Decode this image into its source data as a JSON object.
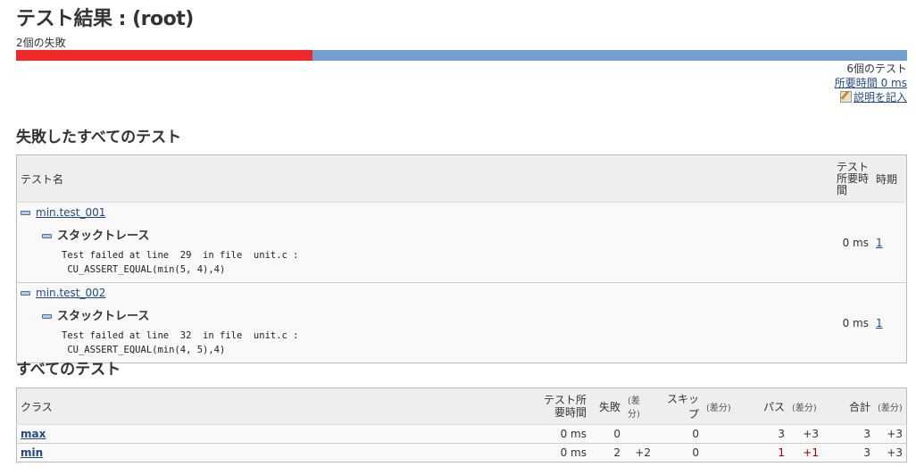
{
  "title": "テスト結果 : (root)",
  "failure_summary": "2個の失敗",
  "progress": {
    "failed": 2,
    "total": 6,
    "fail_fraction": 0.333,
    "fail_color": "#ef2929",
    "pass_color": "#729fcf"
  },
  "summary": {
    "test_count": "6個のテスト",
    "duration": "所要時間 0 ms",
    "edit_description": "説明を記入",
    "edit_icon": "notepad-pencil-icon"
  },
  "failed_section": {
    "heading": "失敗したすべてのテスト",
    "headers": {
      "name": "テスト名",
      "duration": "テスト所要時間",
      "age": "時期"
    },
    "rows": [
      {
        "name": "min.test_001",
        "trace_label": "スタックトレース",
        "trace_line1": "Test failed at line  29  in file  unit.c :",
        "trace_line2": " CU_ASSERT_EQUAL(min(5, 4),4)",
        "duration": "0 ms",
        "age": "1"
      },
      {
        "name": "min.test_002",
        "trace_label": "スタックトレース",
        "trace_line1": "Test failed at line  32  in file  unit.c :",
        "trace_line2": " CU_ASSERT_EQUAL(min(4, 5),4)",
        "duration": "0 ms",
        "age": "1"
      }
    ]
  },
  "all_section": {
    "heading": "すべてのテスト",
    "headers": {
      "class": "クラス",
      "duration": "テスト所要時間",
      "fail": "失敗",
      "skip": "スキップ",
      "pass": "パス",
      "total": "合計",
      "diff": "(差分)"
    },
    "rows": [
      {
        "class": "max",
        "duration": "0 ms",
        "fail": "0",
        "fail_diff": "",
        "skip": "0",
        "skip_diff": "",
        "pass": "3",
        "pass_diff": "+3",
        "total": "3",
        "total_diff": "+3"
      },
      {
        "class": "min",
        "duration": "0 ms",
        "fail": "2",
        "fail_diff": "+2",
        "skip": "0",
        "skip_diff": "",
        "pass": "1",
        "pass_diff": "+1",
        "total": "3",
        "total_diff": "+3"
      }
    ]
  }
}
